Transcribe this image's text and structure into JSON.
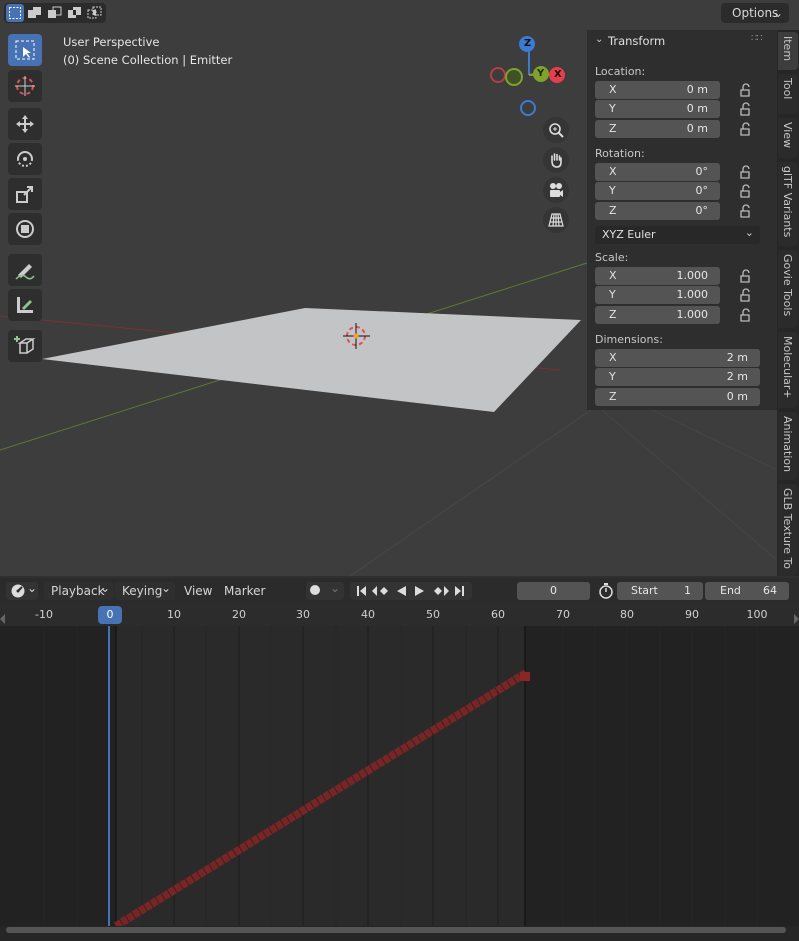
{
  "viewport": {
    "view_name": "User Perspective",
    "collection_info": "(0) Scene Collection | Emitter",
    "options_label": "Options",
    "gizmo": {
      "z": "Z",
      "y": "Y",
      "x": "X"
    },
    "icons": {
      "modes": [
        "select-box-icon",
        "mode-extend-icon",
        "mode-subtract-icon",
        "mode-difference-icon",
        "mode-intersect-icon"
      ],
      "tools": [
        "select-box-icon",
        "cursor-icon",
        "move-icon",
        "rotate-icon",
        "scale-icon",
        "transform-icon",
        "annotate-icon",
        "measure-icon",
        "add-cube-icon"
      ],
      "nav": [
        "zoom-icon",
        "pan-hand-icon",
        "camera-icon",
        "grid-perspective-icon"
      ]
    }
  },
  "transform_panel": {
    "title": "Transform",
    "location": {
      "label": "Location:",
      "x": "0 m",
      "y": "0 m",
      "z": "0 m"
    },
    "rotation": {
      "label": "Rotation:",
      "x": "0°",
      "y": "0°",
      "z": "0°"
    },
    "rotation_mode": "XYZ Euler",
    "scale": {
      "label": "Scale:",
      "x": "1.000",
      "y": "1.000",
      "z": "1.000"
    },
    "dimensions": {
      "label": "Dimensions:",
      "x": "2 m",
      "y": "2 m",
      "z": "0 m"
    },
    "axis_labels": {
      "x": "X",
      "y": "Y",
      "z": "Z"
    }
  },
  "sidebar_tabs": [
    "Item",
    "Tool",
    "View",
    "glTF Variants",
    "Govie Tools",
    "Molecular+",
    "Animation",
    "GLB Texture To"
  ],
  "timeline": {
    "menus": {
      "playback": "Playback",
      "keying": "Keying",
      "view": "View",
      "marker": "Marker"
    },
    "current_frame": "0",
    "start_label": "Start",
    "start_value": "1",
    "end_label": "End",
    "end_value": "64",
    "playhead_label": "0",
    "ruler_ticks": [
      "-10",
      "10",
      "20",
      "30",
      "40",
      "50",
      "60",
      "70",
      "80",
      "90",
      "100"
    ]
  },
  "colors": {
    "accent": "#4772b3",
    "curve": "#7a2424",
    "x_axis": "#e2404f",
    "y_axis": "#7ea22c",
    "z_axis": "#3b7bd0"
  }
}
